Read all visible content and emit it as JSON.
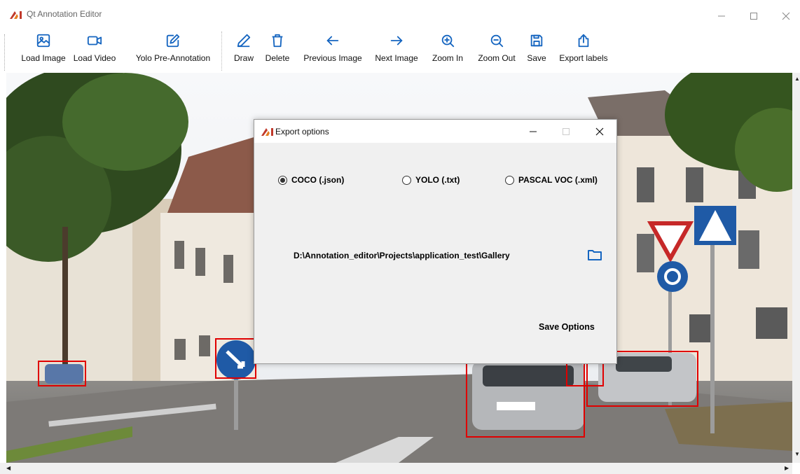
{
  "window": {
    "title": "Qt Annotation Editor",
    "controls": [
      "minimize",
      "maximize",
      "close"
    ]
  },
  "toolbar": {
    "load_image": "Load Image",
    "load_video": "Load Video",
    "yolo_pre": "Yolo Pre-Annotation",
    "draw": "Draw",
    "delete": "Delete",
    "previous_image": "Previous Image",
    "next_image": "Next Image",
    "zoom_in": "Zoom In",
    "zoom_out": "Zoom Out",
    "save": "Save",
    "export_labels": "Export labels",
    "icon_color": "#1565c0"
  },
  "canvas": {
    "annotation_color": "#e00000"
  },
  "dialog": {
    "title": "Export options",
    "formats": [
      {
        "label": "COCO (.json)",
        "selected": true
      },
      {
        "label": "YOLO (.txt)",
        "selected": false
      },
      {
        "label": "PASCAL VOC (.xml)",
        "selected": false
      }
    ],
    "path": "D:\\Annotation_editor\\Projects\\application_test\\Gallery",
    "save_label": "Save Options"
  }
}
